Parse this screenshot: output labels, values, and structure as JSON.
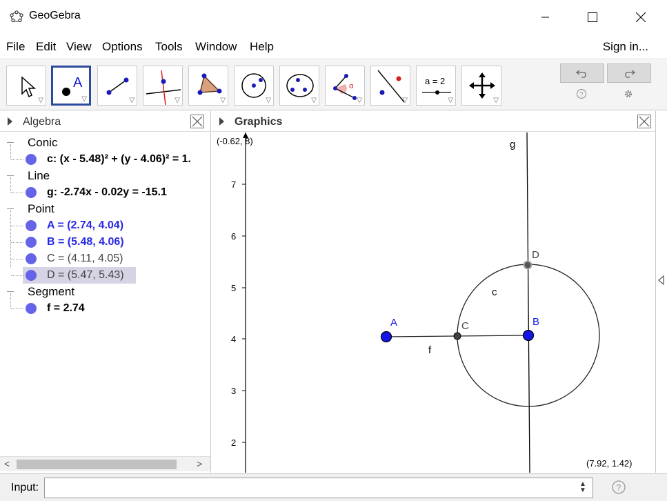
{
  "window": {
    "title": "GeoGebra"
  },
  "menu": {
    "items": [
      "File",
      "Edit",
      "View",
      "Options",
      "Tools",
      "Window",
      "Help"
    ],
    "sign_in": "Sign in..."
  },
  "toolbar": {
    "tools": [
      {
        "name": "move-tool",
        "icon": "arrow-pointer-icon"
      },
      {
        "name": "point-tool",
        "icon": "point-a-icon",
        "selected": true,
        "label": "A"
      },
      {
        "name": "segment-tool",
        "icon": "segment-icon"
      },
      {
        "name": "perpendicular-line-tool",
        "icon": "perpendicular-line-icon"
      },
      {
        "name": "polygon-tool",
        "icon": "polygon-icon"
      },
      {
        "name": "circle-center-point-tool",
        "icon": "circle-center-icon"
      },
      {
        "name": "circle-three-points-tool",
        "icon": "circle-three-points-icon"
      },
      {
        "name": "angle-tool",
        "icon": "angle-icon",
        "label": "α"
      },
      {
        "name": "reflect-tool",
        "icon": "reflect-icon"
      },
      {
        "name": "slider-tool",
        "icon": "slider-icon",
        "label": "a = 2"
      },
      {
        "name": "move-graphics-tool",
        "icon": "move-graphics-icon"
      }
    ]
  },
  "algebra": {
    "title": "Algebra",
    "groups": [
      {
        "label": "Conic",
        "items": [
          {
            "text": "c: (x - 5.48)² + (y - 4.06)² = 1.",
            "color": "#000000"
          }
        ]
      },
      {
        "label": "Line",
        "items": [
          {
            "text": "g: -2.74x - 0.02y = -15.1",
            "color": "#000000"
          }
        ]
      },
      {
        "label": "Point",
        "items": [
          {
            "text": "A = (2.74, 4.04)",
            "color": "#2727e6"
          },
          {
            "text": "B = (5.48, 4.06)",
            "color": "#2727e6"
          },
          {
            "text": "C = (4.11, 4.05)",
            "color": "#444444"
          },
          {
            "text": "D = (5.47, 5.43)",
            "color": "#444444",
            "highlighted": true
          }
        ]
      },
      {
        "label": "Segment",
        "items": [
          {
            "text": "f = 2.74",
            "color": "#000000"
          }
        ]
      }
    ]
  },
  "graphics": {
    "title": "Graphics",
    "corner_top_left": "(-0.62, 8)",
    "corner_bottom_right": "(7.92, 1.42)",
    "y_ticks": [
      "7",
      "6",
      "5",
      "4",
      "3",
      "2"
    ],
    "labels": {
      "A": "A",
      "B": "B",
      "C": "C",
      "D": "D",
      "c": "c",
      "f": "f",
      "g": "g"
    },
    "colors": {
      "free_point": "#1515e6",
      "dependent_point": "#444444",
      "line": "#000000"
    }
  },
  "input_bar": {
    "label": "Input:",
    "value": "",
    "placeholder": ""
  }
}
